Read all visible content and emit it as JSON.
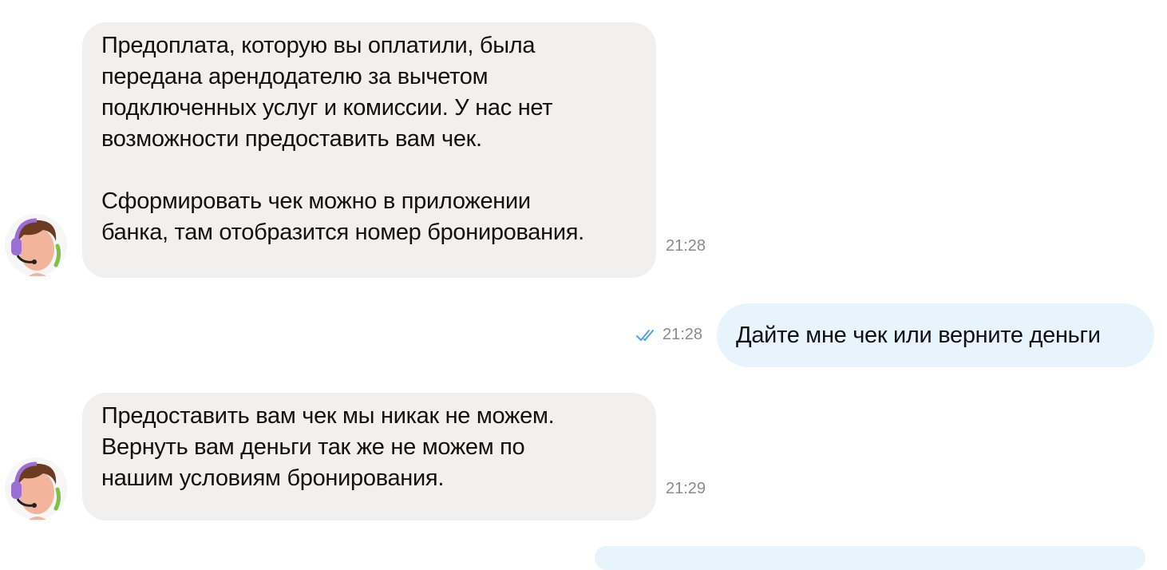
{
  "chat": {
    "messages": [
      {
        "direction": "incoming",
        "sender_avatar": "support-agent-avatar",
        "paragraphs": [
          [
            "Предоплата, которую вы оплатили, была",
            "передана арендодателю за вычетом",
            "подключенных услуг и комиссии. У нас нет",
            "возможности предоставить вам чек."
          ],
          [
            "Сформировать чек можно в приложении",
            "банка, там отобразится номер бронирования."
          ]
        ],
        "time": "21:28"
      },
      {
        "direction": "outgoing",
        "text": "Дайте мне чек или верните деньги",
        "time": "21:28",
        "status_icon": "double-check-icon"
      },
      {
        "direction": "incoming",
        "sender_avatar": "support-agent-avatar",
        "paragraphs": [
          [
            "Предоставить вам чек мы никак не можем.",
            "Вернуть вам деньги так же не можем по",
            "нашим условиям бронирования."
          ]
        ],
        "time": "21:29"
      }
    ]
  },
  "colors": {
    "incoming_bubble": "#f1f0ef",
    "outgoing_bubble": "#e7f4fc",
    "timestamp": "#8a8a8a",
    "read_check": "#4aa3e8",
    "avatar_headset": "#9b6fd6",
    "avatar_accent": "#7dc242"
  }
}
